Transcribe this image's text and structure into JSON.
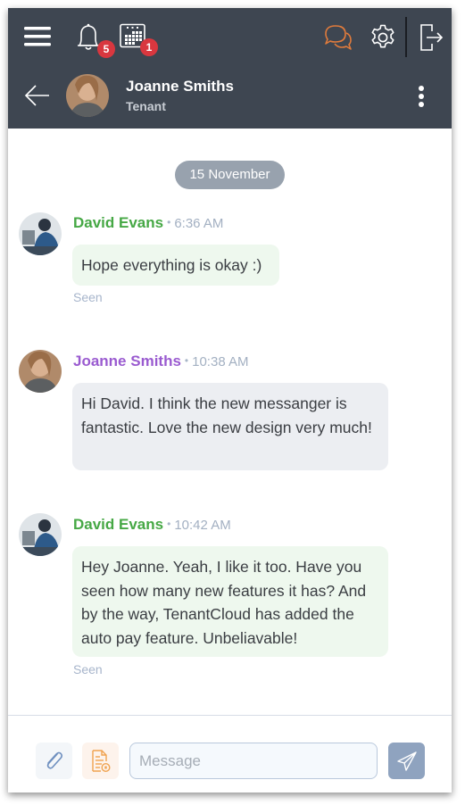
{
  "topbar": {
    "menu_icon": "hamburger-menu-icon",
    "notifications": {
      "icon": "bell-icon",
      "count": "5"
    },
    "calendar": {
      "icon": "calendar-icon",
      "count": "1"
    },
    "chat_icon": "chat-bubbles-icon",
    "settings_icon": "gear-icon",
    "logout_icon": "logout-icon",
    "colors": {
      "background": "#3e4651",
      "chat_active": "#e07b3c",
      "badge": "#d9373f"
    }
  },
  "contact_header": {
    "back_icon": "arrow-left-icon",
    "name": "Joanne Smiths",
    "role": "Tenant",
    "more_icon": "more-vertical-icon"
  },
  "conversation": {
    "date_separator": "15 November",
    "messages": [
      {
        "sender": "David Evans",
        "sender_color": "#46a845",
        "time": "6:36 AM",
        "text": "Hope everything is okay :)",
        "status": "Seen"
      },
      {
        "sender": "Joanne Smiths",
        "sender_color": "#9a5bd0",
        "time": "10:38 AM",
        "text": "Hi David. I think the new messanger is fantastic. Love the new design very much!",
        "status": ""
      },
      {
        "sender": "David Evans",
        "sender_color": "#46a845",
        "time": "10:42 AM",
        "text": "Hey Joanne. Yeah, I like it too. Have you seen how many new features it has? And by the way, TenantCloud has added the auto pay feature. Unbeliavable!",
        "status": "Seen"
      }
    ]
  },
  "composer": {
    "attach_icon": "paperclip-icon",
    "document_icon": "document-lock-icon",
    "placeholder": "Message",
    "value": "",
    "send_icon": "paper-plane-icon"
  }
}
